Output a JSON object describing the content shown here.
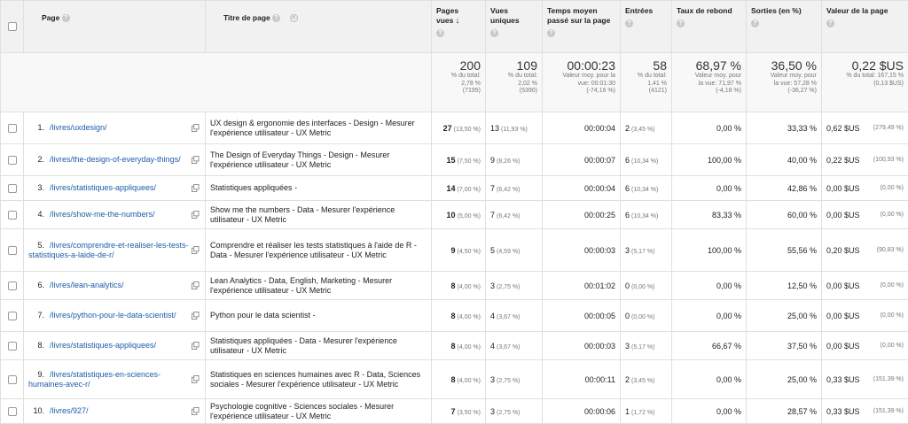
{
  "headers": {
    "page": "Page",
    "title": "Titre de page",
    "pageviews": "Pages vues",
    "unique": "Vues uniques",
    "avgtime": "Temps moyen passé sur la page",
    "entries": "Entrées",
    "bounce": "Taux de rebond",
    "exits": "Sorties (en %)",
    "value": "Valeur de la page"
  },
  "totals": {
    "pageviews": {
      "value": "200",
      "l1": "% du total:",
      "l2": "2,78 %",
      "l3": "(7195)"
    },
    "unique": {
      "value": "109",
      "l1": "% du total:",
      "l2": "2,02 %",
      "l3": "(5390)"
    },
    "avgtime": {
      "value": "00:00:23",
      "l1": "Valeur moy. pour la",
      "l2": "vue: 00:01:30",
      "l3": "(-74,16 %)"
    },
    "entries": {
      "value": "58",
      "l1": "% du total:",
      "l2": "1,41 %",
      "l3": "(4121)"
    },
    "bounce": {
      "value": "68,97 %",
      "l1": "Valeur moy. pour",
      "l2": "la vue: 71,97 %",
      "l3": "(-4,18 %)"
    },
    "exits": {
      "value": "36,50 %",
      "l1": "Valeur moy. pour",
      "l2": "la vue: 57,28 %",
      "l3": "(-36,27 %)"
    },
    "value": {
      "value": "0,22 $US",
      "l1": "% du total: 167,15 %",
      "l2": "(0,13 $US)",
      "l3": ""
    }
  },
  "rows": [
    {
      "idx": "1.",
      "page": "/livres/uxdesign/",
      "title": "UX design & ergonomie des interfaces - Design - Mesurer l'expérience utilisateur - UX Metric",
      "pv": "27",
      "pvp": "(13,50 %)",
      "uv": "13",
      "uvp": "(11,93 %)",
      "time": "00:00:04",
      "en": "2",
      "enp": "(3,45 %)",
      "bounce": "0,00 %",
      "exit": "33,33 %",
      "val": "0,62 $US",
      "valp": "(279,49 %)"
    },
    {
      "idx": "2.",
      "page": "/livres/the-design-of-everyday-things/",
      "title": "The Design of Everyday Things - Design - Mesurer l'expérience utilisateur - UX Metric",
      "pv": "15",
      "pvp": "(7,50 %)",
      "uv": "9",
      "uvp": "(8,26 %)",
      "time": "00:00:07",
      "en": "6",
      "enp": "(10,34 %)",
      "bounce": "100,00 %",
      "exit": "40,00 %",
      "val": "0,22 $US",
      "valp": "(100,93 %)"
    },
    {
      "idx": "3.",
      "page": "/livres/statistiques-appliquees/",
      "title": "Statistiques appliquées -",
      "pv": "14",
      "pvp": "(7,00 %)",
      "uv": "7",
      "uvp": "(6,42 %)",
      "time": "00:00:04",
      "en": "6",
      "enp": "(10,34 %)",
      "bounce": "0,00 %",
      "exit": "42,86 %",
      "val": "0,00 $US",
      "valp": "(0,00 %)"
    },
    {
      "idx": "4.",
      "page": "/livres/show-me-the-numbers/",
      "title": "Show me the numbers - Data - Mesurer l'expérience utilisateur - UX Metric",
      "pv": "10",
      "pvp": "(5,00 %)",
      "uv": "7",
      "uvp": "(6,42 %)",
      "time": "00:00:25",
      "en": "6",
      "enp": "(10,34 %)",
      "bounce": "83,33 %",
      "exit": "60,00 %",
      "val": "0,00 $US",
      "valp": "(0,00 %)"
    },
    {
      "idx": "5.",
      "page": "/livres/comprendre-et-realiser-les-tests-statistiques-a-laide-de-r/",
      "title": "Comprendre et réaliser les tests statistiques à l'aide de R - Data - Mesurer l'expérience utilisateur - UX Metric",
      "pv": "9",
      "pvp": "(4,50 %)",
      "uv": "5",
      "uvp": "(4,59 %)",
      "time": "00:00:03",
      "en": "3",
      "enp": "(5,17 %)",
      "bounce": "100,00 %",
      "exit": "55,56 %",
      "val": "0,20 $US",
      "valp": "(90,83 %)"
    },
    {
      "idx": "6.",
      "page": "/livres/lean-analytics/",
      "title": "Lean Analytics - Data, English, Marketing - Mesurer l'expérience utilisateur - UX Metric",
      "pv": "8",
      "pvp": "(4,00 %)",
      "uv": "3",
      "uvp": "(2,75 %)",
      "time": "00:01:02",
      "en": "0",
      "enp": "(0,00 %)",
      "bounce": "0,00 %",
      "exit": "12,50 %",
      "val": "0,00 $US",
      "valp": "(0,00 %)"
    },
    {
      "idx": "7.",
      "page": "/livres/python-pour-le-data-scientist/",
      "title": "Python pour le data scientist -",
      "pv": "8",
      "pvp": "(4,00 %)",
      "uv": "4",
      "uvp": "(3,67 %)",
      "time": "00:00:05",
      "en": "0",
      "enp": "(0,00 %)",
      "bounce": "0,00 %",
      "exit": "25,00 %",
      "val": "0,00 $US",
      "valp": "(0,00 %)"
    },
    {
      "idx": "8.",
      "page": "/livres/statistiques-appliquees/",
      "title": "Statistiques appliquées - Data - Mesurer l'expérience utilisateur - UX Metric",
      "pv": "8",
      "pvp": "(4,00 %)",
      "uv": "4",
      "uvp": "(3,67 %)",
      "time": "00:00:03",
      "en": "3",
      "enp": "(5,17 %)",
      "bounce": "66,67 %",
      "exit": "37,50 %",
      "val": "0,00 $US",
      "valp": "(0,00 %)"
    },
    {
      "idx": "9.",
      "page": "/livres/statistiques-en-sciences-humaines-avec-r/",
      "title": "Statistiques en sciences humaines avec R - Data, Sciences sociales - Mesurer l'expérience utilisateur - UX Metric",
      "pv": "8",
      "pvp": "(4,00 %)",
      "uv": "3",
      "uvp": "(2,75 %)",
      "time": "00:00:11",
      "en": "2",
      "enp": "(3,45 %)",
      "bounce": "0,00 %",
      "exit": "25,00 %",
      "val": "0,33 $US",
      "valp": "(151,39 %)"
    },
    {
      "idx": "10.",
      "page": "/livres/927/",
      "title": "Psychologie cognitive - Sciences sociales - Mesurer l'expérience utilisateur - UX Metric",
      "pv": "7",
      "pvp": "(3,50 %)",
      "uv": "3",
      "uvp": "(2,75 %)",
      "time": "00:00:06",
      "en": "1",
      "enp": "(1,72 %)",
      "bounce": "0,00 %",
      "exit": "28,57 %",
      "val": "0,33 $US",
      "valp": "(151,39 %)"
    }
  ],
  "colors": {
    "link": "#1a5ea8",
    "header_bg": "#f1f1f1"
  }
}
